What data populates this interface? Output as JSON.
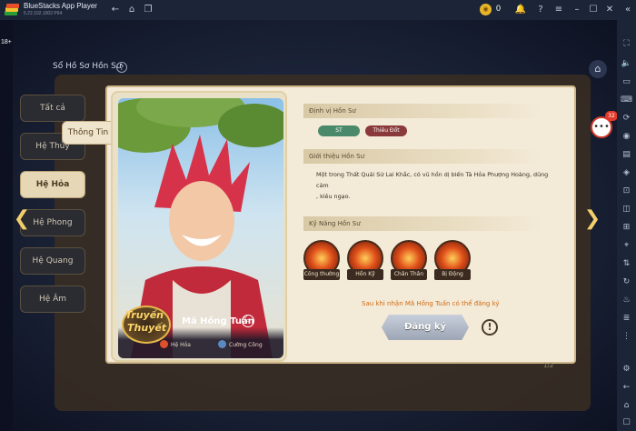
{
  "window": {
    "title": "BlueStacks App Player",
    "version": "5.22.102.1002  P64",
    "coin_count": "0"
  },
  "left_strip": {
    "badge": "18+"
  },
  "header": {
    "title": "Sổ Hồ Sơ Hồn Sư",
    "help": "?"
  },
  "tabs": [
    {
      "label": "Tất cả"
    },
    {
      "label": "Hệ Thủy"
    },
    {
      "label": "Hệ Hỏa"
    },
    {
      "label": "Hệ Phong"
    },
    {
      "label": "Hệ Quang"
    },
    {
      "label": "Hệ Âm"
    }
  ],
  "info_tab": "Thông Tin",
  "card": {
    "rarity_line1": "Truyền",
    "rarity_line2": "Thuyết",
    "name": "Mã Hồng Tuấn",
    "element": "Hệ Hỏa",
    "type": "Cường Công"
  },
  "position_section": {
    "title": "Định vị Hồn Sư",
    "tags": [
      "ST",
      "Thiêu Đốt"
    ]
  },
  "intro_section": {
    "title": "Giới thiệu Hồn Sư",
    "text_line1": "Một trong Thất Quái Sử Lai Khắc, có vũ hồn dị biến Tà Hỏa Phượng Hoàng, dũng cảm",
    "text_line2": ", kiêu ngạo."
  },
  "skills_section": {
    "title": "Kỹ Năng Hồn Sư",
    "skills": [
      "Công thường",
      "Hồn Kỹ",
      "Chân Thân",
      "Bị Động"
    ]
  },
  "unlock_note": "Sau khi nhận Mã Hồng Tuấn có thể đăng ký",
  "register_button": "Đăng ký",
  "pager": "1/2",
  "chat_badge": "32"
}
